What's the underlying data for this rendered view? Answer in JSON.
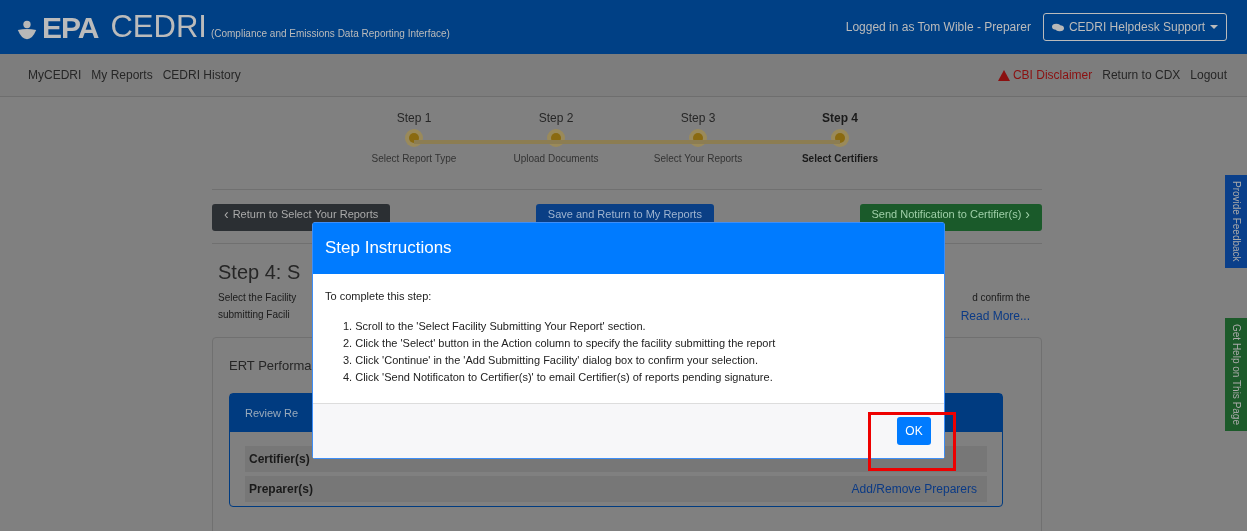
{
  "header": {
    "logo": "EPA",
    "app_name": "CEDRI",
    "app_subtitle": "(Compliance and Emissions Data Reporting Interface)",
    "user": "Logged in as Tom Wible - Preparer",
    "helpdesk": "CEDRI Helpdesk Support"
  },
  "nav": {
    "left": [
      "MyCEDRI",
      "My Reports",
      "CEDRI History"
    ],
    "disclaimer": "CBI Disclaimer",
    "right": [
      "Return to CDX",
      "Logout"
    ]
  },
  "steps": [
    {
      "title": "Step 1",
      "caption": "Select Report Type",
      "selected": false
    },
    {
      "title": "Step 2",
      "caption": "Upload Documents",
      "selected": false
    },
    {
      "title": "Step 3",
      "caption": "Select Your Reports",
      "selected": false
    },
    {
      "title": "Step 4",
      "caption": "Select Certifiers",
      "selected": true
    }
  ],
  "actions": {
    "back_icon": "‹",
    "back": "Return to Select Your Reports",
    "save": "Save and Return to My Reports",
    "next": "Send Notification to Certifier(s)",
    "next_icon": "›"
  },
  "page": {
    "heading": "Step 4: S",
    "intro_left": [
      "Select the Facility",
      "submitting Facili"
    ],
    "intro_right": "d confirm the",
    "read_more": "Read More..."
  },
  "card": {
    "title": "ERT Performa",
    "inner_title": "Review Re",
    "rows": [
      {
        "label": "Certifier(s)"
      },
      {
        "label": "Preparer(s)",
        "link": "Add/Remove Preparers"
      }
    ]
  },
  "side_tabs": [
    {
      "label": "Provide Feedback",
      "color": "#0a3f8a"
    },
    {
      "label": "Get Help on This Page",
      "color": "#1c5a2a"
    }
  ],
  "modal": {
    "title": "Step Instructions",
    "lead": "To complete this step:",
    "steps": [
      "1. Scroll to the 'Select Facility Submitting Your Report' section.",
      "2. Click the 'Select' button in the Action column to specify the facility submitting the report",
      "3. Click 'Continue' in the 'Add Submitting Facility' dialog box to confirm your selection.",
      "4. Click 'Send Notificaton to Certifier(s)' to email Certifier(s) of reports pending signature."
    ],
    "ok": "OK"
  }
}
